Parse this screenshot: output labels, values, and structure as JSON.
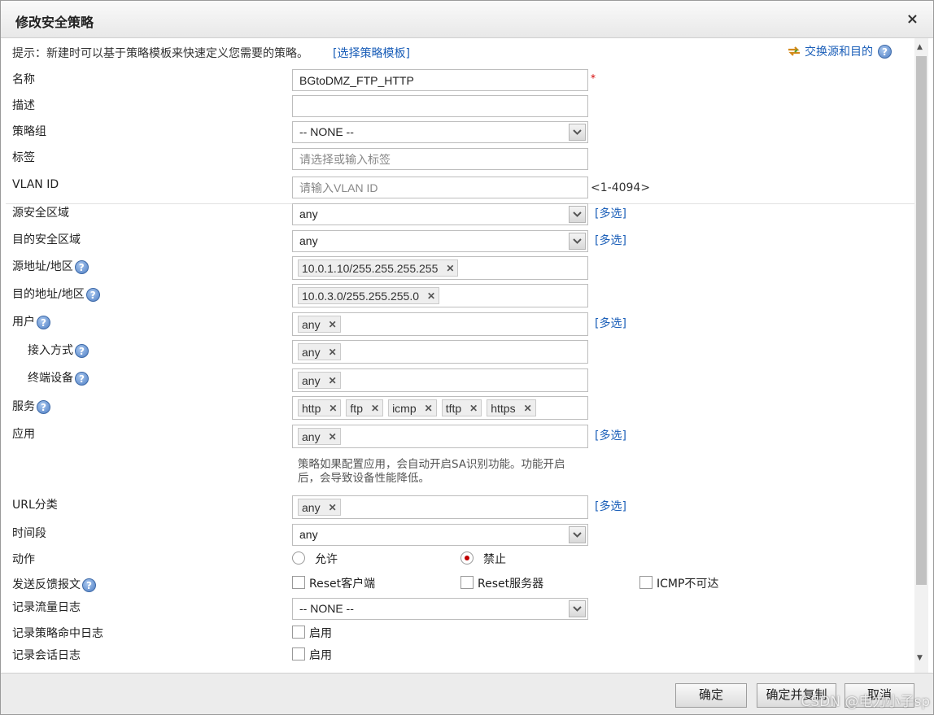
{
  "dialog": {
    "title": "修改安全策略",
    "close": "×"
  },
  "hint": {
    "text": "提示：新建时可以基于策略模板来快速定义您需要的策略。",
    "template_link": "[选择策略模板]",
    "swap_link": "交换源和目的"
  },
  "fields": {
    "name": {
      "label": "名称",
      "value": "BGtoDMZ_FTP_HTTP",
      "required": "*"
    },
    "desc": {
      "label": "描述",
      "value": ""
    },
    "group": {
      "label": "策略组",
      "value": "-- NONE --"
    },
    "tag": {
      "label": "标签",
      "placeholder": "请选择或输入标签"
    },
    "vlan": {
      "label": "VLAN ID",
      "placeholder": "请输入VLAN ID",
      "range": "<1-4094>"
    },
    "src_zone": {
      "label": "源安全区域",
      "value": "any",
      "multi": "[多选]"
    },
    "dst_zone": {
      "label": "目的安全区域",
      "value": "any",
      "multi": "[多选]"
    },
    "src_addr": {
      "label": "源地址/地区",
      "tags": [
        "10.0.1.10/255.255.255.255"
      ]
    },
    "dst_addr": {
      "label": "目的地址/地区",
      "tags": [
        "10.0.3.0/255.255.255.0"
      ]
    },
    "user": {
      "label": "用户",
      "tags": [
        "any"
      ],
      "multi": "[多选]"
    },
    "access": {
      "label": "接入方式",
      "tags": [
        "any"
      ]
    },
    "device": {
      "label": "终端设备",
      "tags": [
        "any"
      ]
    },
    "service": {
      "label": "服务",
      "tags": [
        "http",
        "ftp",
        "icmp",
        "tftp",
        "https"
      ]
    },
    "app": {
      "label": "应用",
      "tags": [
        "any"
      ],
      "multi": "[多选]",
      "note_line1": "策略如果配置应用，会自动开启SA识别功能。功能开启",
      "note_line2": "后，会导致设备性能降低。"
    },
    "url": {
      "label": "URL分类",
      "tags": [
        "any"
      ],
      "multi": "[多选]"
    },
    "time": {
      "label": "时间段",
      "value": "any"
    },
    "action": {
      "label": "动作",
      "permit": "允许",
      "deny": "禁止",
      "selected": "禁止"
    },
    "feedback": {
      "label": "发送反馈报文",
      "opt1": "Reset客户端",
      "opt2": "Reset服务器",
      "opt3": "ICMP不可达"
    },
    "traffic_log": {
      "label": "记录流量日志",
      "value": "-- NONE --"
    },
    "hit_log": {
      "label": "记录策略命中日志",
      "option": "启用"
    },
    "session_log": {
      "label": "记录会话日志",
      "option": "启用"
    }
  },
  "buttons": {
    "ok": "确定",
    "ok_copy": "确定并复制",
    "cancel": "取消"
  },
  "watermark": "CSDN @电力小子sp",
  "icons": {
    "help": "?",
    "tag_remove": "✕",
    "dropdown": "▼"
  }
}
